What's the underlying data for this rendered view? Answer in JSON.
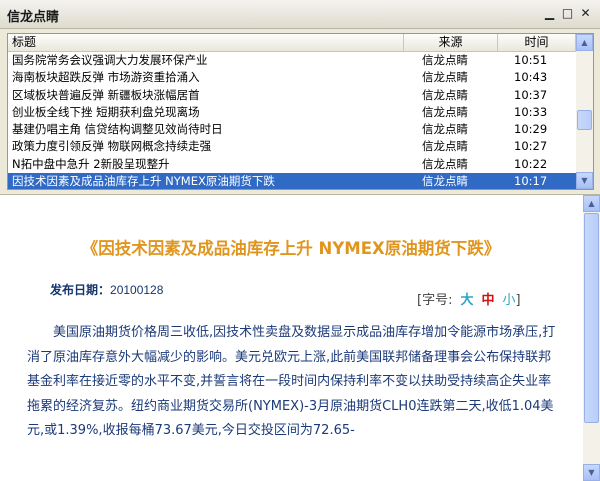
{
  "window": {
    "title": "信龙点睛",
    "minimize": "▁",
    "maximize": "□",
    "close": "✕"
  },
  "list": {
    "columns": {
      "title": "标题",
      "source": "来源",
      "time": "时间"
    },
    "rows": [
      {
        "title": "国务院常务会议强调大力发展环保产业",
        "source": "信龙点睛",
        "time": "10:51"
      },
      {
        "title": "海南板块超跌反弹  市场游资重拾涌入",
        "source": "信龙点睛",
        "time": "10:43"
      },
      {
        "title": "区域板块普遍反弹  新疆板块涨幅居首",
        "source": "信龙点睛",
        "time": "10:37"
      },
      {
        "title": "创业板全线下挫  短期获利盘兑现离场",
        "source": "信龙点睛",
        "time": "10:33"
      },
      {
        "title": "基建仍唱主角 信贷结构调整见效尚待时日",
        "source": "信龙点睛",
        "time": "10:29"
      },
      {
        "title": "政策力度引领反弹  物联网概念持续走强",
        "source": "信龙点睛",
        "time": "10:27"
      },
      {
        "title": "N拓中盘中急升  2新股呈现整升",
        "source": "信龙点睛",
        "time": "10:22"
      },
      {
        "title": "因技术因素及成品油库存上升  NYMEX原油期货下跌",
        "source": "信龙点睛",
        "time": "10:17"
      }
    ],
    "selected_index": 7
  },
  "article": {
    "title": "《因技术因素及成品油库存上升 NYMEX原油期货下跌》",
    "publish_label": "发布日期：",
    "publish_date": "20100128",
    "font_size_label": "[字号:",
    "font_big": "大",
    "font_mid": "中",
    "font_small": "小",
    "font_close": "]",
    "body": "美国原油期货价格周三收低,因技术性卖盘及数据显示成品油库存增加令能源市场承压,打消了原油库存意外大幅减少的影响。美元兑欧元上涨,此前美国联邦储备理事会公布保持联邦基金利率在接近零的水平不变,并誓言将在一段时间内保持利率不变以扶助受持续高企失业率拖累的经济复苏。纽约商业期货交易所(NYMEX)-3月原油期货CLH0连跌第二天,收低1.04美元,或1.39%,收报每桶73.67美元,今日交投区间为72.65-"
  },
  "colors": {
    "selected_row": "#316ac5",
    "article_title": "#e0961e",
    "article_text": "#1b3a78"
  }
}
